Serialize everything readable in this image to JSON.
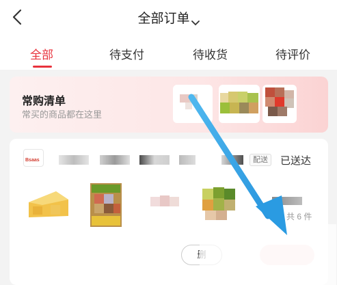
{
  "header": {
    "title": "全部订单"
  },
  "tabs": [
    {
      "label": "全部",
      "active": true
    },
    {
      "label": "待支付",
      "active": false
    },
    {
      "label": "待收货",
      "active": false
    },
    {
      "label": "待评价",
      "active": false
    }
  ],
  "favorites": {
    "title": "常购清单",
    "subtitle": "常买的商品都在这里"
  },
  "order": {
    "delivery_badge": "配送",
    "status": "已送达",
    "item_count": "共 6 件",
    "button_label": "删"
  },
  "colors": {
    "accent": "#e8323c",
    "arrow": "#2ea3e8"
  }
}
